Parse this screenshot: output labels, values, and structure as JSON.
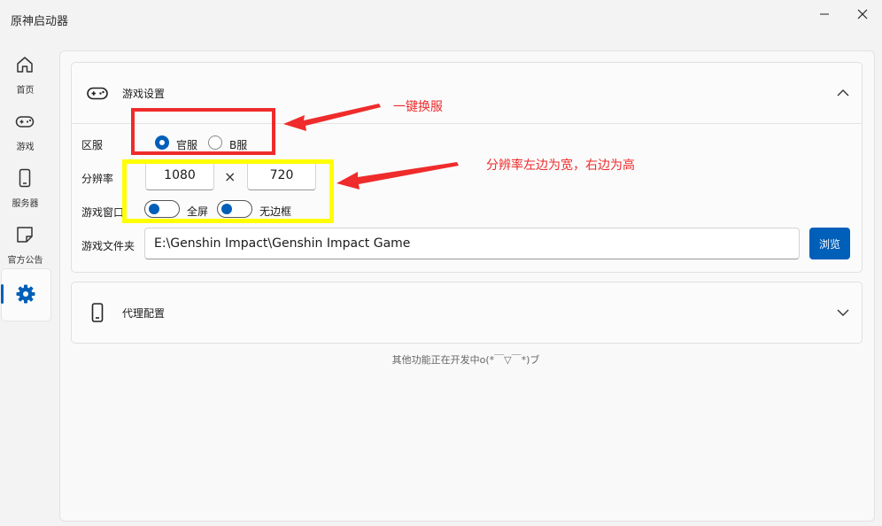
{
  "window": {
    "title": "原神启动器"
  },
  "sidebar": {
    "items": [
      {
        "label": "首页",
        "icon": "home-icon"
      },
      {
        "label": "游戏",
        "icon": "gamepad-icon"
      },
      {
        "label": "服务器",
        "icon": "phone-icon"
      },
      {
        "label": "官方公告",
        "icon": "sticky-note-icon"
      },
      {
        "label": "",
        "icon": "gear-icon",
        "active": true
      }
    ]
  },
  "game_settings": {
    "title": "游戏设置",
    "icon": "gamepad-icon",
    "server": {
      "label": "区服",
      "options": [
        {
          "label": "官服",
          "checked": true
        },
        {
          "label": "B服",
          "checked": false
        }
      ]
    },
    "resolution": {
      "label": "分辨率",
      "width": "1080",
      "separator": "×",
      "height": "720"
    },
    "window_mode": {
      "label": "游戏窗口",
      "toggles": [
        {
          "label": "全屏",
          "on": false
        },
        {
          "label": "无边框",
          "on": false
        }
      ]
    },
    "folder": {
      "label": "游戏文件夹",
      "path": "E:\\Genshin Impact\\Genshin Impact Game",
      "browse_label": "浏览"
    }
  },
  "proxy_settings": {
    "title": "代理配置",
    "icon": "phone-icon"
  },
  "footer_note": "其他功能正在开发中o(*￣▽￣*)ブ",
  "annotations": {
    "server_switch": "一键换服",
    "resolution_hint": "分辨率左边为宽，右边为高"
  },
  "colors": {
    "accent": "#005fb8",
    "annotation_red": "#ef2b2b",
    "highlight_yellow": "#ffff00"
  }
}
